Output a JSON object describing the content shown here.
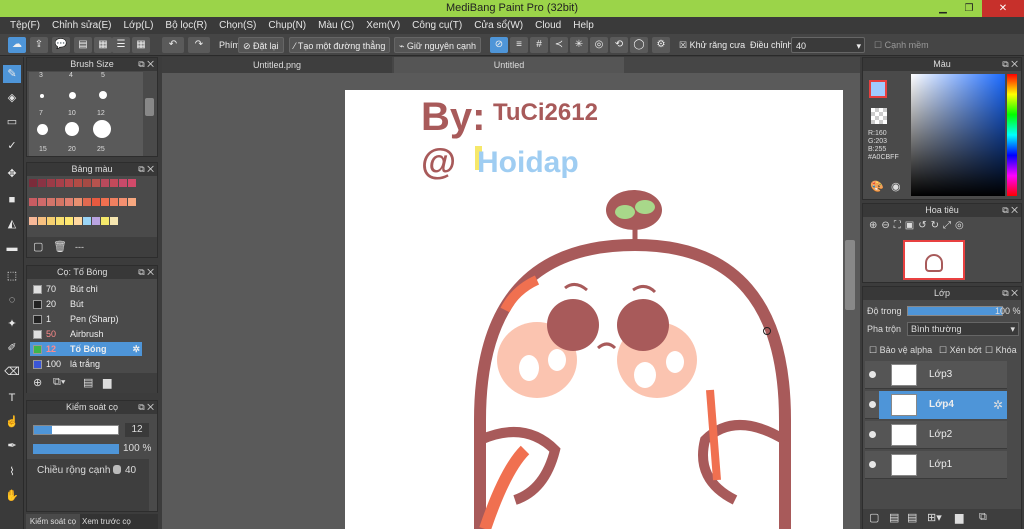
{
  "window": {
    "title": "MediBang Paint Pro (32bit)"
  },
  "menu": [
    "Tệp(F)",
    "Chỉnh sửa(E)",
    "Lớp(L)",
    "Bộ lọc(R)",
    "Chọn(S)",
    "Chụp(N)",
    "Màu (C)",
    "Xem(V)",
    "Công cụ(T)",
    "Cửa sổ(W)",
    "Cloud",
    "Help"
  ],
  "toolbar": {
    "phim_label": "Phím",
    "reset_label": "Đặt lại",
    "straight_label": "Tạo một đường thẳng",
    "keep_edge_label": "Giữ nguyên cạnh",
    "antialias_label": "Khử răng cưa",
    "adjust_label": "Điều chỉnh",
    "adjust_value": "40",
    "soft_edge_label": "Cạnh mềm"
  },
  "tabs": [
    "Untitled.png",
    "Untitled"
  ],
  "brush_size": {
    "title": "Brush Size",
    "sizes": [
      "3",
      "4",
      "5",
      "7",
      "10",
      "12",
      "15",
      "20",
      "25"
    ]
  },
  "palette": {
    "title": "Bảng màu",
    "colors": [
      "#7a2b3a",
      "#8a3344",
      "#9c3b47",
      "#a8404a",
      "#b3474b",
      "#b24c45",
      "#a54a44",
      "#b6534e",
      "#b84a5c",
      "#c24a5a",
      "#c84a6a",
      "#d24a6a",
      "#c95c62",
      "#cf6a6a",
      "#d4756a",
      "#d47564",
      "#e08070",
      "#e89070",
      "#e06a50",
      "#e85a40",
      "#f07050",
      "#f08060",
      "#f49070",
      "#f8a880",
      "#f8b898",
      "#f7c080",
      "#f6d070",
      "#f9e070",
      "#ffe870",
      "#ffd8a0",
      "#9ad4f5",
      "#b9a3e0",
      "#f4e86a",
      "#f6e6b0"
    ],
    "more": "---"
  },
  "brush_list": {
    "title": "Cọ: Tố Bóng",
    "items": [
      {
        "size": "70",
        "name": "Bút chì",
        "color": "#e0e0e0"
      },
      {
        "size": "20",
        "name": "Bút",
        "color": "#222222"
      },
      {
        "size": "1",
        "name": "Pen (Sharp)",
        "color": "#222222"
      },
      {
        "size": "50",
        "name": "Airbrush",
        "color": "#e0e0e0"
      },
      {
        "size": "12",
        "name": "Tố Bóng",
        "color": "#3fb64a"
      },
      {
        "size": "100",
        "name": "lá trắng",
        "color": "#3a56d8"
      }
    ]
  },
  "brush_control": {
    "title": "Kiểm soát cọ",
    "size_value": "12",
    "opacity_value": "100 %",
    "edge_label": "Chiều rộng cạnh",
    "edge_value": "40"
  },
  "bottom_tabs": [
    "Kiểm soát cọ",
    "Xem trước cọ"
  ],
  "color_panel": {
    "title": "Màu",
    "r": "R:160",
    "g": "G:203",
    "b": "B:255",
    "hex": "#A0CBFF",
    "primary": "#a0cbff"
  },
  "navigator": {
    "title": "Hoa tiêu"
  },
  "layer_panel": {
    "title": "Lớp",
    "opacity_label": "Độ trong",
    "opacity_value": "100 %",
    "blend_label": "Pha trộn",
    "blend_value": "Bình thường",
    "protect_alpha": "Bảo vệ alpha",
    "clip": "Xén bớt",
    "lock": "Khóa",
    "layers": [
      "Lớp3",
      "Lớp4",
      "Lớp2",
      "Lớp1"
    ]
  },
  "drawing": {
    "text1": "By:",
    "text2": "TuCi2612",
    "text3": "@",
    "text4": "Hoidap"
  }
}
